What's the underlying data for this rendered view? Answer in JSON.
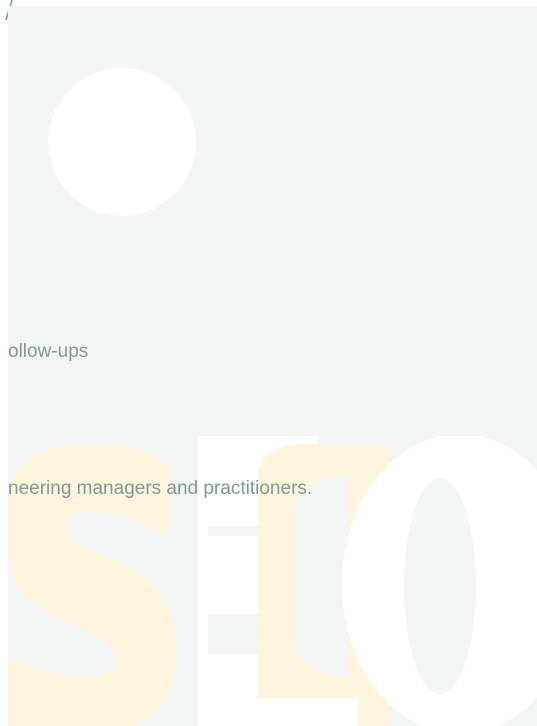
{
  "content": {
    "followups_fragment": "ollow-ups",
    "audience_fragment": "neering managers and practitioners."
  },
  "watermark": {
    "logo_text": "SEC",
    "colors": {
      "orange": "#fff5de",
      "white": "#ffffff",
      "panel": "#f3f5f4"
    }
  },
  "theme": {
    "text_color": "#7f9996",
    "background": "#f3f5f4"
  }
}
